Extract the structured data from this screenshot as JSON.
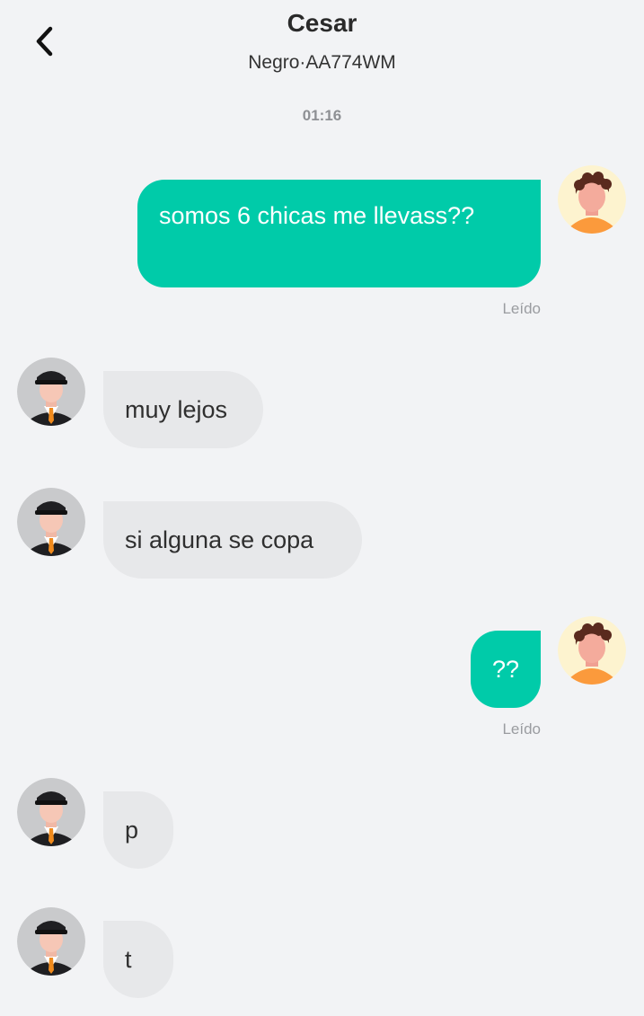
{
  "header": {
    "title": "Cesar",
    "subtitle": "Negro·AA774WM",
    "back_icon": "chevron-left-icon"
  },
  "chat": {
    "timestamp": "01:16",
    "messages": [
      {
        "direction": "outgoing",
        "text": "somos 6 chicas me llevass??",
        "status": "Leído",
        "avatar": "user-avatar"
      },
      {
        "direction": "incoming",
        "text": "muy lejos",
        "avatar": "driver-avatar"
      },
      {
        "direction": "incoming",
        "text": "si alguna se copa",
        "avatar": "driver-avatar"
      },
      {
        "direction": "outgoing",
        "text": "??",
        "status": "Leído",
        "avatar": "user-avatar"
      },
      {
        "direction": "incoming",
        "text": "p",
        "avatar": "driver-avatar"
      },
      {
        "direction": "incoming",
        "text": "t",
        "avatar": "driver-avatar"
      }
    ]
  },
  "colors": {
    "outgoing_bubble": "#00cba9",
    "incoming_bubble": "#e7e8ea",
    "background": "#f2f3f5"
  }
}
